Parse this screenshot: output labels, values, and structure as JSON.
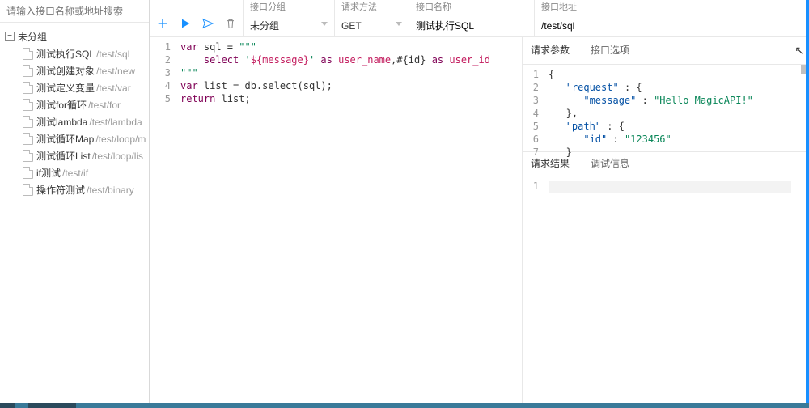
{
  "search": {
    "placeholder": "请输入接口名称或地址搜索"
  },
  "tree": {
    "groupToggle": "−",
    "groupName": "未分组",
    "items": [
      {
        "name": "测试执行SQL",
        "path": "/test/sql"
      },
      {
        "name": "测试创建对象",
        "path": "/test/new"
      },
      {
        "name": "测试定义变量",
        "path": "/test/var"
      },
      {
        "name": "测试for循环",
        "path": "/test/for"
      },
      {
        "name": "测试lambda",
        "path": "/test/lambda"
      },
      {
        "name": "测试循环Map",
        "path": "/test/loop/m"
      },
      {
        "name": "测试循环List",
        "path": "/test/loop/lis"
      },
      {
        "name": "if测试",
        "path": "/test/if"
      },
      {
        "name": "操作符测试",
        "path": "/test/binary"
      }
    ]
  },
  "header": {
    "groupLabel": "接口分组",
    "groupValue": "未分组",
    "methodLabel": "请求方法",
    "methodValue": "GET",
    "nameLabel": "接口名称",
    "nameValue": "测试执行SQL",
    "urlLabel": "接口地址",
    "urlValue": "/test/sql"
  },
  "editor": {
    "lines": [
      "1",
      "2",
      "3",
      "4",
      "5"
    ],
    "l1_kw": "var",
    "l1_rest": " sql = ",
    "l1_str": "\"\"\"",
    "l2_pad": "    ",
    "l2_kw1": "select",
    "l2_str1": " '${message}' ",
    "l2_kw2": "as",
    "l2_v1": " user_name",
    "l2_mid": ",#{id} ",
    "l2_kw3": "as",
    "l2_v2": " user_id",
    "l3_str": "\"\"\"",
    "l4_kw": "var",
    "l4_rest": " list = db.select(sql);",
    "l5_kw": "return",
    "l5_rest": " list;"
  },
  "rpanel": {
    "tab1": "请求参数",
    "tab2": "接口选项",
    "reqLines": [
      "1",
      "2",
      "3",
      "4",
      "5",
      "6",
      "7"
    ],
    "j_open": "{",
    "j2_key": "\"request\"",
    "j2_mid": " : {",
    "j3_key": "\"message\"",
    "j3_mid": " : ",
    "j3_val": "\"Hello MagicAPI!\"",
    "j4": "},",
    "j5_key": "\"path\"",
    "j5_mid": " : {",
    "j6_key": "\"id\"",
    "j6_mid": " : ",
    "j6_val": "\"123456\"",
    "j7": "}",
    "tab3": "请求结果",
    "tab4": "调试信息",
    "resultLine": "1"
  },
  "colors": {
    "accent": "#1890ff"
  }
}
